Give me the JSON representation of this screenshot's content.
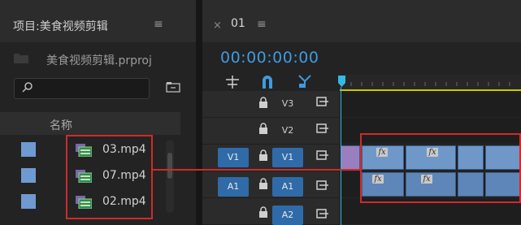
{
  "colors": {
    "accent": "#3f9be0",
    "track_button": "#2f6ba8",
    "clip_video": "#6f98c9",
    "highlight": "#d02a2a",
    "playhead": "#35b8e6"
  },
  "project": {
    "title": "项目:美食视频剪辑",
    "menu_icon": "≡",
    "file_name": "美食视频剪辑.prproj",
    "search_placeholder": "",
    "column_name": "名称",
    "clips": [
      {
        "name": "03.mp4"
      },
      {
        "name": "07.mp4"
      },
      {
        "name": "02.mp4"
      }
    ]
  },
  "timeline": {
    "close_icon": "×",
    "sequence_name": "01",
    "menu_icon": "≡",
    "timecode": "00:00:00:00",
    "tools": [
      "insert-icon",
      "magnet-icon",
      "marker-icon"
    ],
    "tracks": [
      {
        "target": "V3",
        "source": ""
      },
      {
        "target": "V2",
        "source": ""
      },
      {
        "target": "V1",
        "source": "V1"
      },
      {
        "target": "A1",
        "source": "A1"
      },
      {
        "target": "A2",
        "source": ""
      }
    ],
    "fx_label": "fx"
  }
}
